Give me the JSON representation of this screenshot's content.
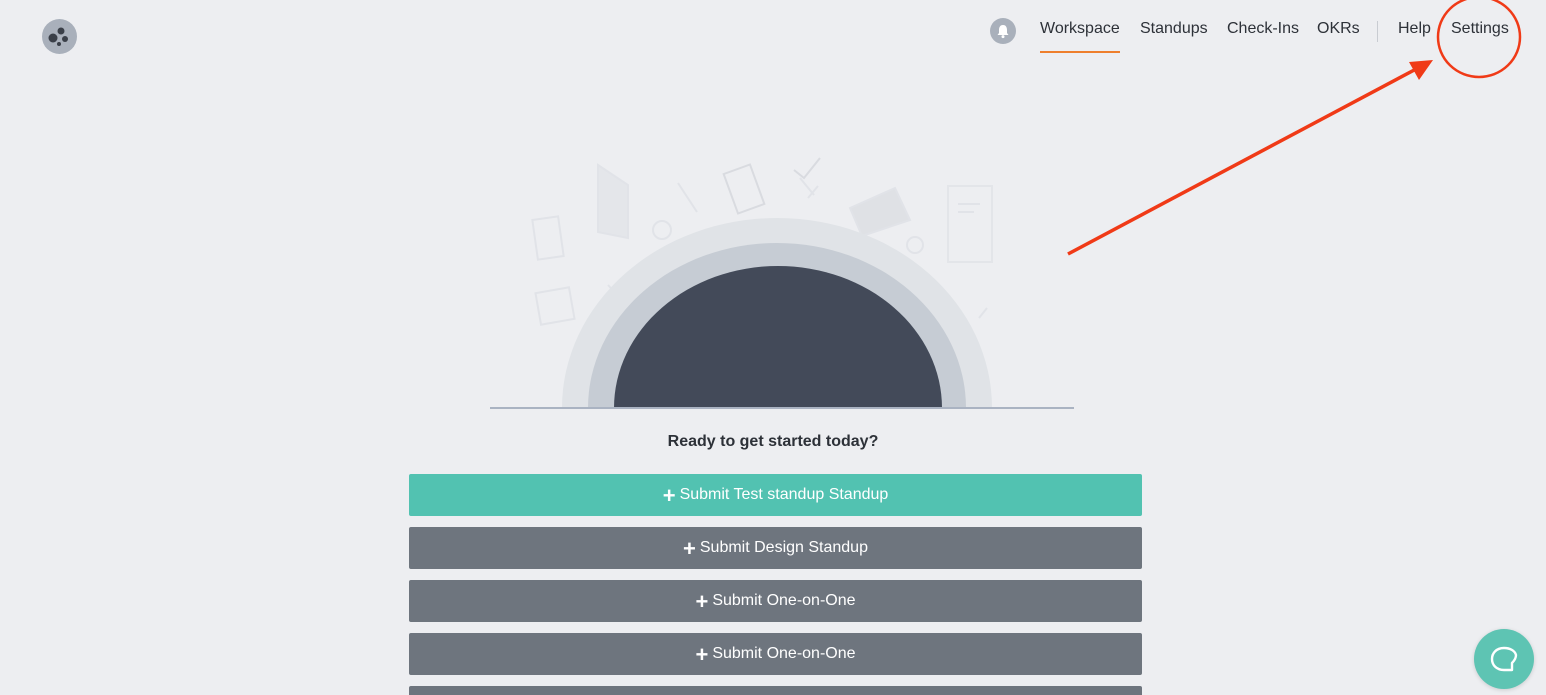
{
  "app": {
    "logo_icon": "dots-logo-icon"
  },
  "nav": {
    "bell_icon": "bell-icon",
    "items": [
      {
        "label": "Workspace",
        "active": true
      },
      {
        "label": "Standups",
        "active": false
      },
      {
        "label": "Check-Ins",
        "active": false
      },
      {
        "label": "OKRs",
        "active": false
      },
      {
        "label": "Help",
        "active": false
      },
      {
        "label": "Settings",
        "active": false
      }
    ]
  },
  "main": {
    "prompt": "Ready to get started today?",
    "buttons": [
      {
        "label": "Submit Test standup Standup",
        "style": "primary"
      },
      {
        "label": "Submit Design Standup",
        "style": "secondary"
      },
      {
        "label": "Submit One-on-One",
        "style": "secondary"
      },
      {
        "label": "Submit One-on-One",
        "style": "secondary"
      },
      {
        "label": "",
        "style": "secondary"
      }
    ],
    "plus_icon": "+"
  },
  "chat": {
    "icon": "chat-bubble-icon"
  },
  "colors": {
    "accent_orange": "#ee7f2d",
    "primary_teal": "#52c2b1",
    "secondary_gray": "#6e757e",
    "annotation_red": "#f03a17",
    "background": "#edeef1"
  }
}
